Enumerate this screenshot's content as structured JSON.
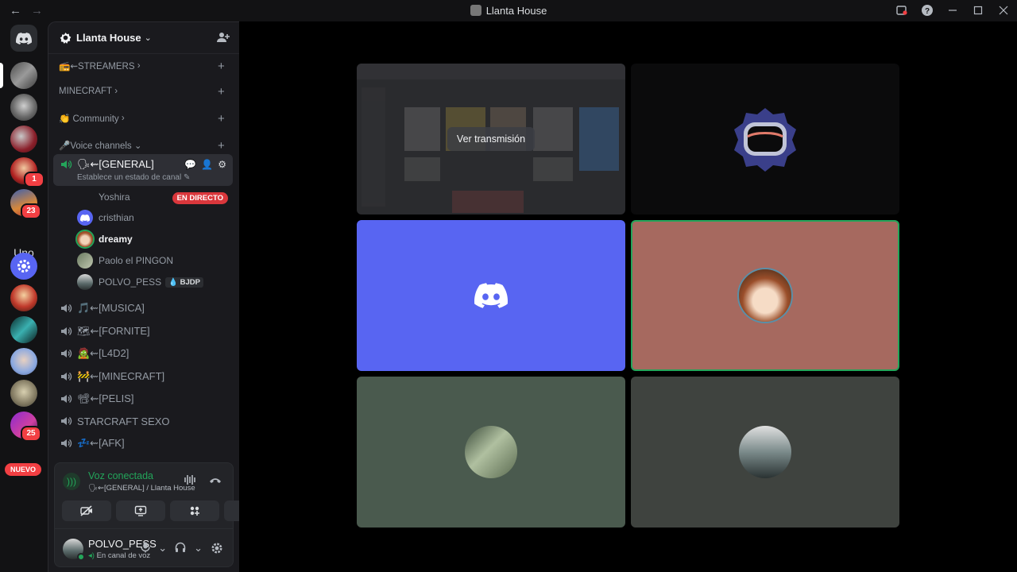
{
  "window": {
    "title": "Llanta House",
    "nav_back": "←",
    "nav_forward": "→"
  },
  "rail": {
    "badges": [
      "1",
      "23",
      "25"
    ],
    "uno_label": "Uno",
    "nuevo_label": "NUEVO"
  },
  "server": {
    "name": "Llanta House",
    "categories": [
      {
        "label": "📻⇜STREAMERS"
      },
      {
        "label": "MINECRAFT"
      },
      {
        "label": "👏 Community"
      },
      {
        "label": "🎤Voice channels"
      }
    ],
    "active_channel": {
      "name": "🗣⇜[GENERAL]",
      "status_placeholder": "Establece un estado de canal"
    },
    "users": [
      {
        "name": "Yoshira",
        "live": "EN DIRECTO"
      },
      {
        "name": "cristhian"
      },
      {
        "name": "dreamy"
      },
      {
        "name": "Paolo el PINGON"
      },
      {
        "name": "POLVO_PESS",
        "tag": "💧 BJDP"
      }
    ],
    "channels": [
      {
        "name": "🎵⇜[MUSICA]"
      },
      {
        "name": "🗺⇜[FORNITE]"
      },
      {
        "name": "🧟⇜[L4D2]"
      },
      {
        "name": "🚧⇜[MINECRAFT]"
      },
      {
        "name": "📽⇜[PELIS]"
      },
      {
        "name": "STARCRAFT SEXO"
      },
      {
        "name": "💤⇜[AFK]"
      }
    ]
  },
  "voice_panel": {
    "status": "Voz conectada",
    "location": "🗣⇜[GENERAL] / Llanta House"
  },
  "me": {
    "name": "POLVO_PESS",
    "status": "En canal de voz"
  },
  "stage": {
    "stream_button": "Ver transmisión"
  },
  "colors": {
    "blurple": "#5865f2",
    "green": "#23a55a",
    "red": "#f23f43"
  }
}
